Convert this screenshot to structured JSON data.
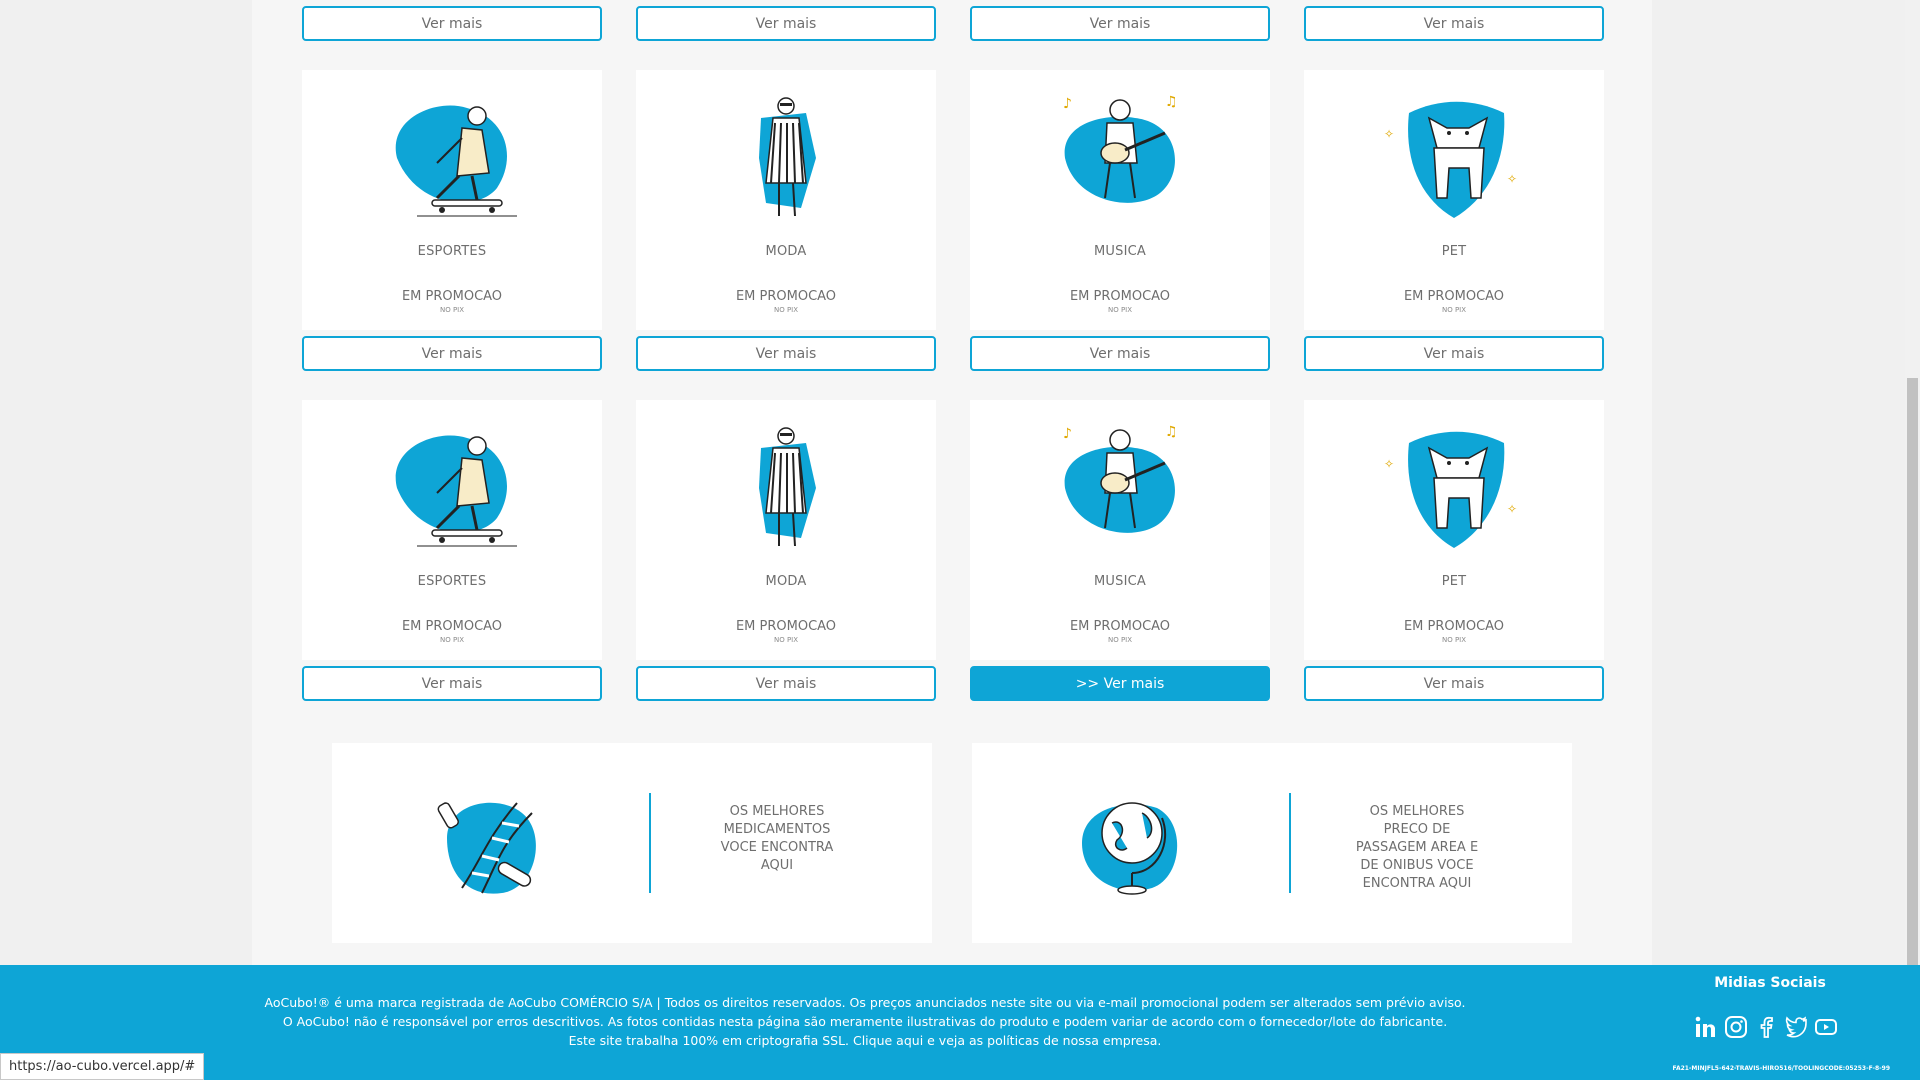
{
  "buttons": {
    "ver_mais": "Ver mais",
    "active_label": ">> Ver mais"
  },
  "row1": [
    {
      "category": "ESPORTES",
      "promo": "EM PROMOCAO",
      "pix": "NO PIX",
      "icon": "skater-icon"
    },
    {
      "category": "MODA",
      "promo": "EM PROMOCAO",
      "pix": "NO PIX",
      "icon": "fashion-icon"
    },
    {
      "category": "MUSICA",
      "promo": "EM PROMOCAO",
      "pix": "NO PIX",
      "icon": "guitarist-icon"
    },
    {
      "category": "PET",
      "promo": "EM PROMOCAO",
      "pix": "NO PIX",
      "icon": "dog-icon"
    }
  ],
  "row2": [
    {
      "category": "ESPORTES",
      "promo": "EM PROMOCAO",
      "pix": "NO PIX",
      "icon": "skater-icon"
    },
    {
      "category": "MODA",
      "promo": "EM PROMOCAO",
      "pix": "NO PIX",
      "icon": "fashion-icon"
    },
    {
      "category": "MUSICA",
      "promo": "EM PROMOCAO",
      "pix": "NO PIX",
      "icon": "guitarist-icon"
    },
    {
      "category": "PET",
      "promo": "EM PROMOCAO",
      "pix": "NO PIX",
      "icon": "dog-icon"
    }
  ],
  "banners": [
    {
      "text_lines": [
        "OS MELHORES",
        "MEDICAMENTOS",
        "VOCE ENCONTRA",
        "AQUI"
      ],
      "icon": "dna-medicine-icon"
    },
    {
      "text_lines": [
        "OS MELHORES",
        "PRECO DE",
        "PASSAGEM AREA E",
        "DE ONIBUS VOCE",
        "ENCONTRA AQUI"
      ],
      "icon": "globe-icon"
    }
  ],
  "footer": {
    "legal_lines": [
      "AoCubo!® é uma marca registrada de AoCubo COMÉRCIO S/A | Todos os direitos reservados. Os preços anunciados neste site ou via e-mail promocional podem ser alterados sem prévio aviso.",
      "O AoCubo! não é responsável por erros descritivos. As fotos contidas nesta página são meramente ilustrativas do produto e podem variar de acordo com o fornecedor/lote do fabricante.",
      "Este site trabalha 100% em criptografia SSL. Clique aqui e veja as políticas de nossa empresa."
    ],
    "social_title": "Midias Sociais",
    "social_icons": [
      "linkedin-icon",
      "instagram-icon",
      "facebook-icon",
      "twitter-icon",
      "youtube-icon"
    ],
    "tooling": "FA21-MINJFL5-642-TRAVIS-HIRO516/TOOLINGCODE:05253-F-8-99"
  },
  "status_url": "https://ao-cubo.vercel.app/#",
  "colors": {
    "accent": "#0ea5d6",
    "page_bg": "#f0f0f0"
  }
}
